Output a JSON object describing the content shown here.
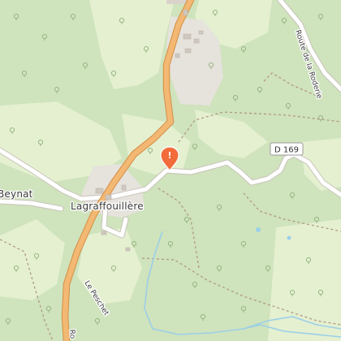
{
  "map": {
    "place_label": "Lagraffouillère",
    "partial_place_label": "Beynat",
    "road_shield": "D 169",
    "street_labels": {
      "route_de_la_roderie": "Route de la Roderie",
      "le_peschet": "Le Peschet",
      "bottom_road": "Ro"
    },
    "marker": {
      "icon": "map-pin-marker-icon",
      "symbol": "!",
      "color": "#f26b3a"
    },
    "colors": {
      "forest": "#cfe3bd",
      "meadow": "#e4f0d0",
      "settlement": "#e6e2dc",
      "main_road": "#f3b873",
      "minor_road": "#ffffff",
      "water": "#9ccfe8"
    }
  }
}
